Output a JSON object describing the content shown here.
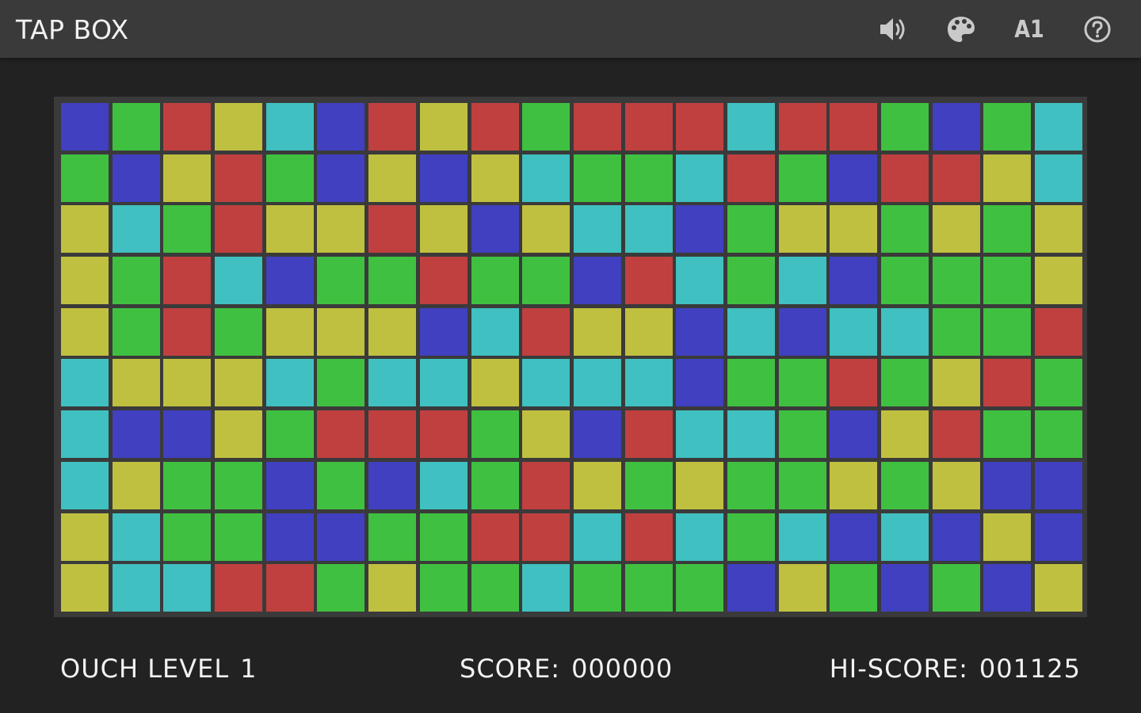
{
  "app": {
    "title": "TAP BOX"
  },
  "toolbar": {
    "sound_icon": "speaker-icon",
    "theme_icon": "palette-icon",
    "font_label": "A1",
    "help_icon": "help-circle-icon",
    "icon_color": "#c9c9c9"
  },
  "colors": {
    "background": "#222222",
    "topbar": "#3a3a3a",
    "board_frame": "#3a3a3a",
    "text": "#f2f2f2",
    "B": "#4040c0",
    "G": "#40c040",
    "R": "#c04040",
    "Y": "#c0c040",
    "C": "#40c0c0"
  },
  "board": {
    "rows": [
      "BGRYCBRYRGRRRCRRGBGC",
      "GBYRGBYBYCGGCRGBRRYC",
      "YCGRYYRYBYCCBGYYGYGY",
      "YGRCBGGRGGBRCGCBGGGY",
      "YGRGYYYBCRYYBCBCCGGR",
      "CYYYCGCCYCCCBGGRGYRG",
      "CBBYGRRRGYBRCCGBYRGG",
      "CYGGBGBCGRYGYGGYGYBB",
      "YCGGBBGGRRCRCGCBCBYB",
      "YCCRRGYGGCGGGBYGBGBY"
    ]
  },
  "status": {
    "level_label": "OUCH LEVEL",
    "level_value": "1",
    "score_label": "SCORE:",
    "score_value": "000000",
    "hiscore_label": "HI-SCORE:",
    "hiscore_value": "001125"
  }
}
